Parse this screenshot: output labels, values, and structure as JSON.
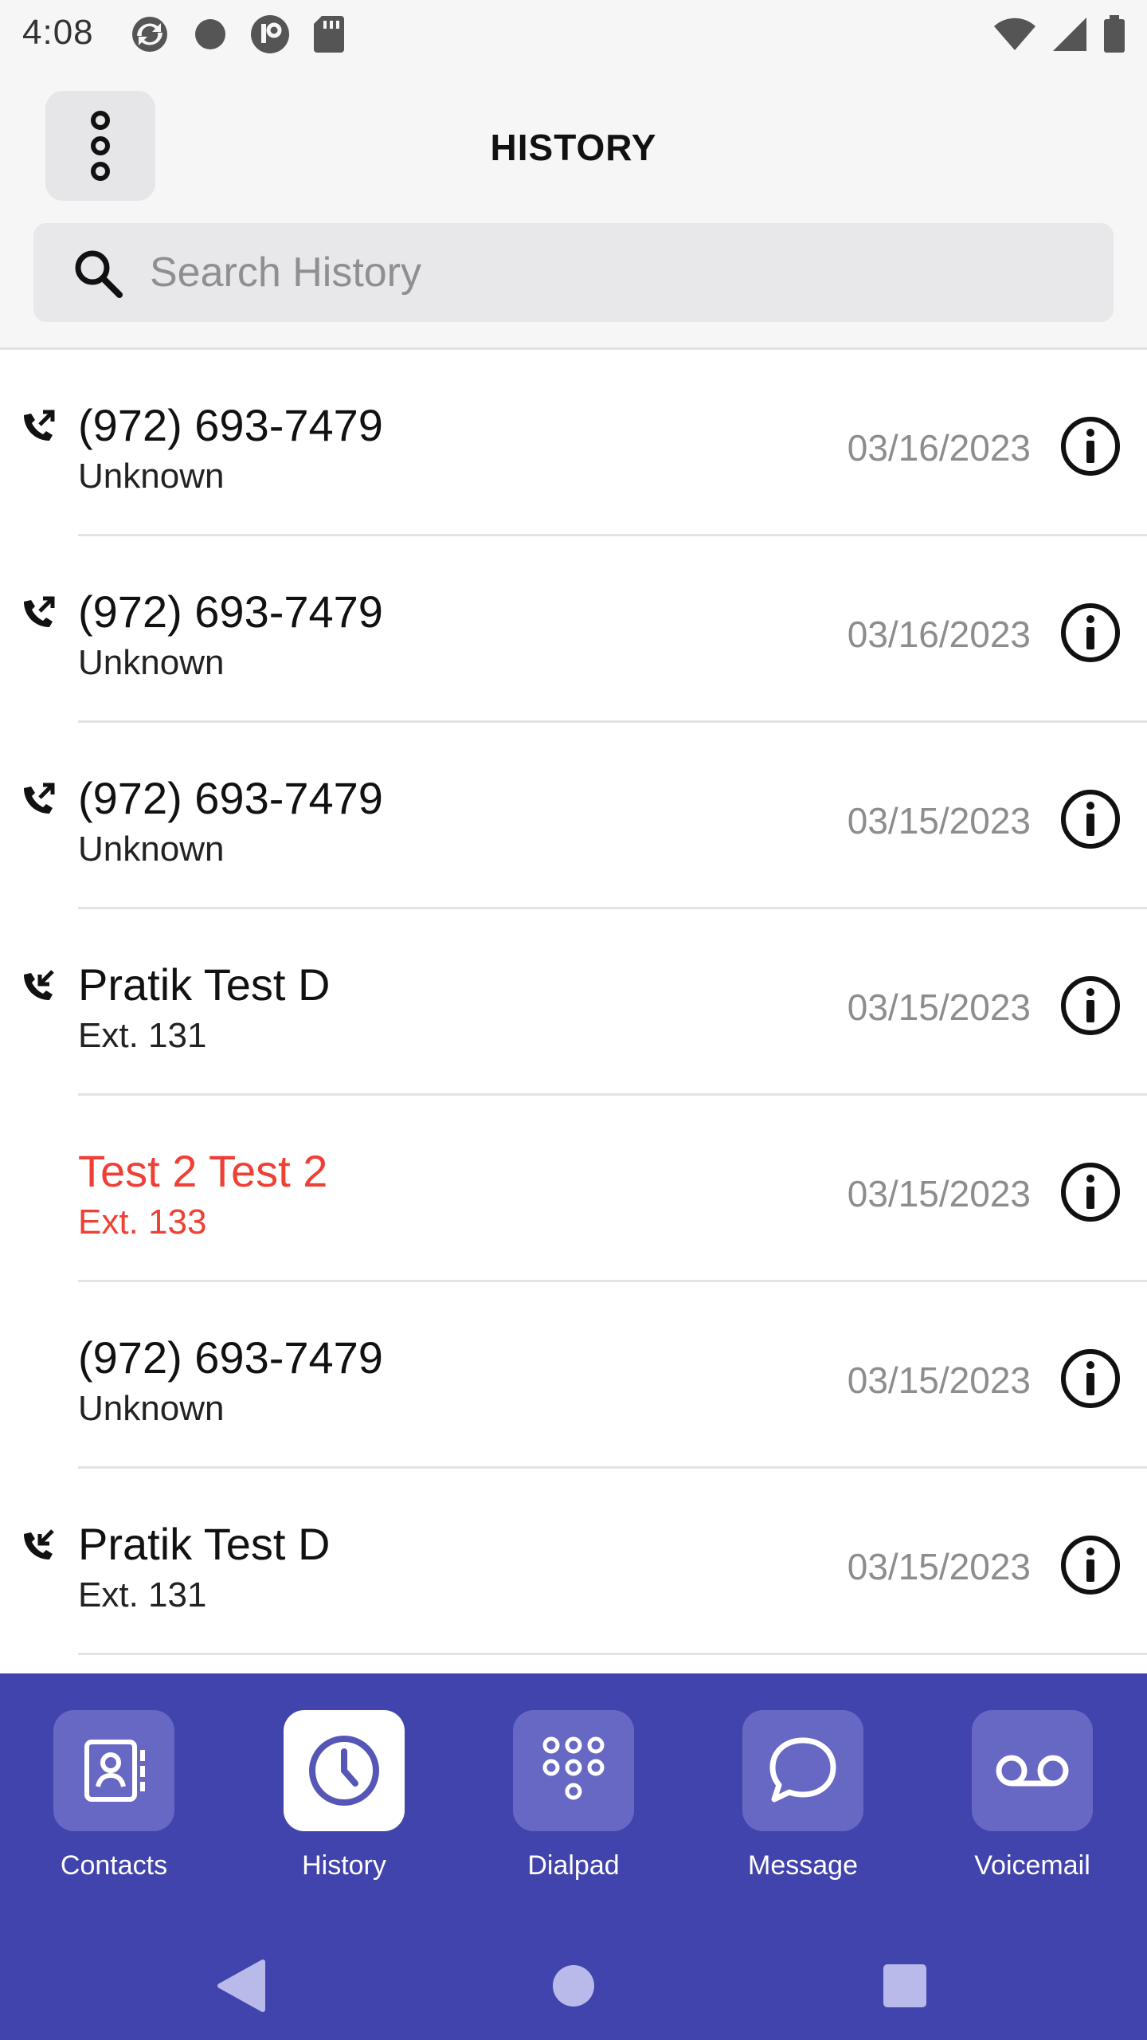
{
  "status_bar": {
    "time": "4:08",
    "left_icons": [
      "sync-icon",
      "dot-icon",
      "app-icon",
      "sd-card-icon"
    ],
    "right_icons": [
      "wifi-icon",
      "signal-icon",
      "battery-icon"
    ]
  },
  "header": {
    "title": "HISTORY",
    "menu_icon": "more-vertical-icon"
  },
  "search": {
    "placeholder": "Search History",
    "value": ""
  },
  "calls": [
    {
      "name": "(972) 693-7479",
      "sub": "Unknown",
      "date": "03/16/2023",
      "type": "outgoing",
      "missed": false
    },
    {
      "name": "(972) 693-7479",
      "sub": "Unknown",
      "date": "03/16/2023",
      "type": "outgoing",
      "missed": false
    },
    {
      "name": "(972) 693-7479",
      "sub": "Unknown",
      "date": "03/15/2023",
      "type": "outgoing",
      "missed": false
    },
    {
      "name": "Pratik Test D",
      "sub": "Ext. 131",
      "date": "03/15/2023",
      "type": "incoming",
      "missed": false
    },
    {
      "name": "Test 2 Test 2",
      "sub": "Ext. 133",
      "date": "03/15/2023",
      "type": "missed",
      "missed": true
    },
    {
      "name": "(972) 693-7479",
      "sub": "Unknown",
      "date": "03/15/2023",
      "type": "none",
      "missed": false
    },
    {
      "name": "Pratik Test D",
      "sub": "Ext. 131",
      "date": "03/15/2023",
      "type": "incoming",
      "missed": false
    }
  ],
  "nav": {
    "items": [
      {
        "label": "Contacts",
        "icon": "contacts-icon",
        "active": false
      },
      {
        "label": "History",
        "icon": "clock-icon",
        "active": true
      },
      {
        "label": "Dialpad",
        "icon": "dialpad-icon",
        "active": false
      },
      {
        "label": "Message",
        "icon": "message-icon",
        "active": false
      },
      {
        "label": "Voicemail",
        "icon": "voicemail-icon",
        "active": false
      }
    ]
  },
  "colors": {
    "nav_background": "#4244ad",
    "nav_tile": "#6767c4",
    "active_icon": "#5656b6",
    "missed": "#ee4035",
    "date": "#8d8d8d"
  }
}
